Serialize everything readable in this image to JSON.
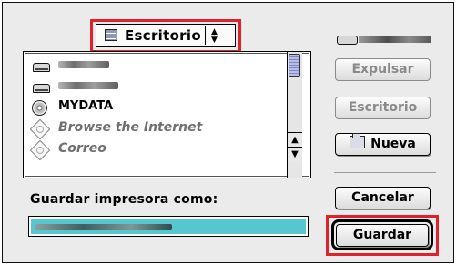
{
  "location_popup": {
    "label": "Escritorio",
    "arrows": "▲▼"
  },
  "file_list": {
    "items": [
      {
        "kind": "disk",
        "label": "",
        "muted": false
      },
      {
        "kind": "disk",
        "label": "",
        "muted": false
      },
      {
        "kind": "cd",
        "label": "MYDATA",
        "muted": false
      },
      {
        "kind": "alias",
        "label": "Browse the Internet",
        "muted": true
      },
      {
        "kind": "alias",
        "label": "Correo",
        "muted": true
      }
    ]
  },
  "side_buttons": {
    "eject": "Expulsar",
    "desktop": "Escritorio",
    "new": "Nueva",
    "cancel": "Cancelar",
    "save": "Guardar"
  },
  "save_as": {
    "label": "Guardar impresora como:",
    "value": ""
  },
  "colors": {
    "highlight_box": "#e0202a",
    "selection": "#56c7cf"
  }
}
